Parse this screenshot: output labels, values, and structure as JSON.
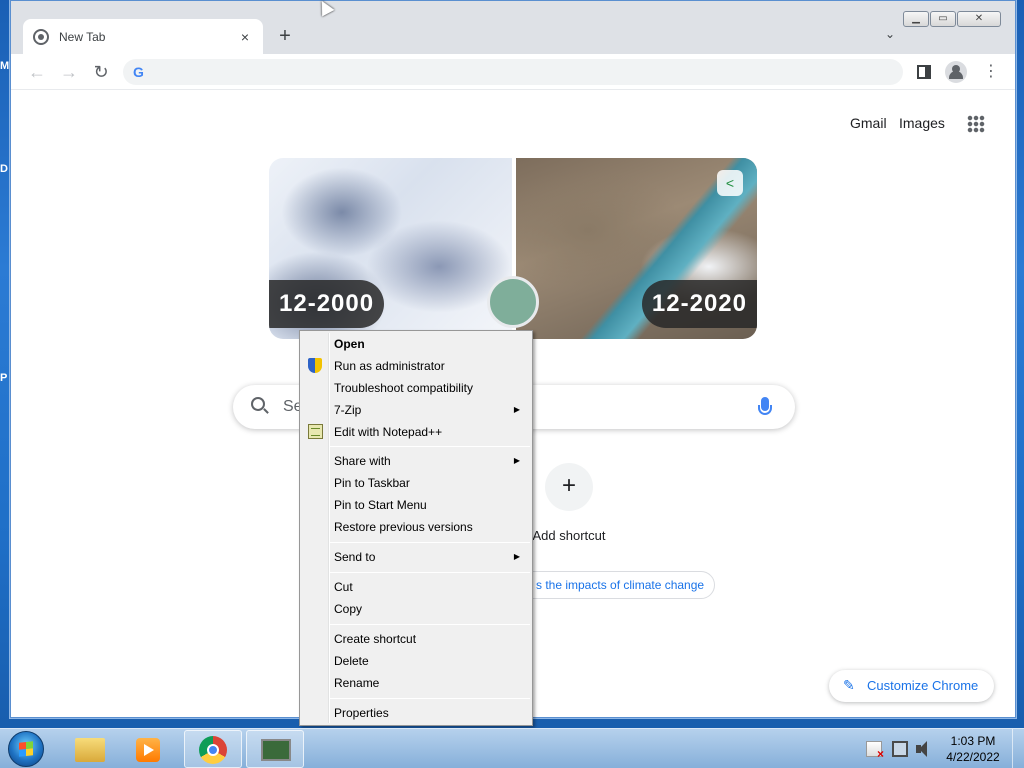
{
  "desktop": {
    "peek_letters": [
      "M",
      "D",
      "P"
    ]
  },
  "browser": {
    "tab": {
      "title": "New Tab",
      "close": "×"
    },
    "new_tab": "+",
    "tab_search": "⌄",
    "window_buttons": {
      "minimize": "▁",
      "maximize": "▭",
      "close": "✕"
    },
    "nav": {
      "back": "←",
      "forward": "→",
      "reload": "↻"
    },
    "omnibox": {
      "value": "",
      "logo": "G"
    },
    "menu": "⋮"
  },
  "ntp": {
    "links": {
      "gmail": "Gmail",
      "images": "Images"
    },
    "doodle": {
      "left_label": "12-2000",
      "right_label": "12-2020"
    },
    "search_placeholder": "Se",
    "shortcut": {
      "plus": "+",
      "label": "Add shortcut"
    },
    "promo_text": "s the impacts of climate change",
    "customize_label": "Customize Chrome"
  },
  "context_menu": {
    "items": [
      {
        "label": "Open",
        "bold": true
      },
      {
        "label": "Run as administrator",
        "icon": "shield-icon"
      },
      {
        "label": "Troubleshoot compatibility"
      },
      {
        "label": "7-Zip",
        "submenu": true
      },
      {
        "label": "Edit with Notepad++",
        "icon": "notepad-icon"
      },
      {
        "label": "Share with",
        "submenu": true
      },
      {
        "label": "Pin to Taskbar"
      },
      {
        "label": "Pin to Start Menu"
      },
      {
        "label": "Restore previous versions"
      },
      {
        "label": "Send to",
        "submenu": true
      },
      {
        "label": "Cut"
      },
      {
        "label": "Copy"
      },
      {
        "label": "Create shortcut"
      },
      {
        "label": "Delete"
      },
      {
        "label": "Rename"
      },
      {
        "label": "Properties"
      }
    ],
    "submenu_arrow": "▶"
  },
  "taskbar": {
    "clock_time": "1:03 PM",
    "clock_date": "4/22/2022"
  },
  "colors": {
    "accent": "#1a73e8",
    "desktop": "#1f6fc7",
    "menu_bg": "#f0f0f0"
  }
}
